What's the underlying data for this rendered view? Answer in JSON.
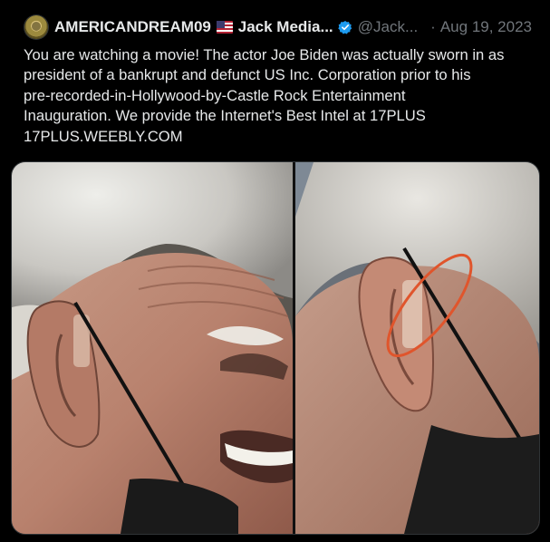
{
  "tweet": {
    "display_name": "AMERICANDREAM09",
    "flag": "🇺🇸",
    "display_name_suffix": "Jack Media...",
    "handle": "@Jack...",
    "separator": "·",
    "date": "Aug 19, 2023",
    "text": "You are watching a movie! The actor Joe Biden was actually sworn in as\npresident of a bankrupt and defunct US Inc. Corporation prior to his\npre-recorded-in-Hollywood-by-Castle Rock Entertainment\nInauguration. We provide the Internet's Best Intel at 17PLUS\n17PLUS.WEEBLY.COM",
    "icons": {
      "avatar": "avatar-coin-icon",
      "verified": "verified-badge-icon",
      "flag": "us-flag-icon"
    },
    "colors": {
      "background": "#000000",
      "text": "#e7e9ea",
      "muted": "#71767b",
      "verified": "#1d9bf0",
      "annotation_circle": "#e0552c"
    }
  }
}
